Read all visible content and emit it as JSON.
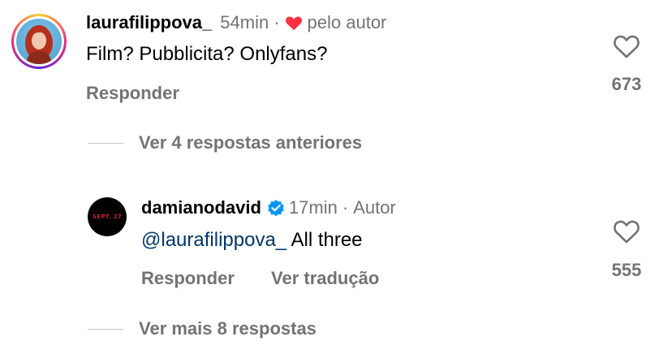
{
  "comments": [
    {
      "username": "laurafilippova_",
      "time": "54min",
      "liked_by_author_label": "pelo autor",
      "text": "Film? Pubblicita? Onlyfans?",
      "reply_label": "Responder",
      "like_count": "673",
      "view_previous_replies": "Ver 4 respostas anteriores"
    },
    {
      "username": "damianodavid",
      "verified": true,
      "time": "17min",
      "author_label": "Autor",
      "mention": "@laurafilippova_",
      "text": " All three",
      "reply_label": "Responder",
      "translate_label": "Ver tradução",
      "like_count": "555",
      "avatar_text": "SEPT. 27",
      "view_more_replies": "Ver mais 8 respostas"
    }
  ],
  "colors": {
    "secondary_text": "#737373",
    "mention": "#00376b",
    "heart_red": "#ff3040",
    "verified_blue": "#0095f6"
  }
}
